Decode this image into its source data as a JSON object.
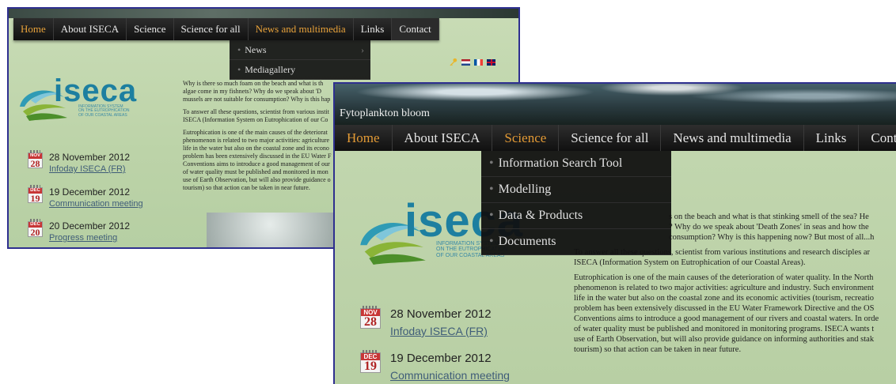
{
  "back": {
    "nav": [
      {
        "label": "Home",
        "active": true
      },
      {
        "label": "About ISECA"
      },
      {
        "label": "Science"
      },
      {
        "label": "Science for all"
      },
      {
        "label": "News and multimedia",
        "active": true
      },
      {
        "label": "Links"
      },
      {
        "label": "Contact"
      }
    ],
    "dropdown": [
      "News",
      "Mediagallery"
    ],
    "logo": {
      "name": "iseca",
      "sub": [
        "INFORMATION SYSTEM",
        "ON THE EUTROPHICATION",
        "OF OUR COASTAL AREAS"
      ]
    },
    "paragraphs": [
      "Why is there so much foam on the beach and what is th",
      "algae come in my fishnets? Why do we speak about 'D",
      "mussels are not suitable for consumption? Why is this hap",
      "To answer all these questions, scientist from various instit",
      "ISECA (Information System on Eutrophication of our Co",
      "Eutrophication is one of the main causes of the deteriorat",
      "phenomenon is related to two major activities: agriculture",
      "life in the water but also on the coastal zone and its econo",
      "problem has been extensively discussed in the EU Water F",
      "Conventions aims to introduce a good management of our",
      "of water quality must be published and monitored in mon",
      "use of Earth Observation, but will also provide guidance o",
      "tourism) so that action can be taken in near future."
    ],
    "events": [
      {
        "month": "NOV",
        "day": "28",
        "date": "28 November 2012",
        "link": "Infoday ISECA (FR)"
      },
      {
        "month": "DEC",
        "day": "19",
        "date": "19 December 2012",
        "link": "Communication meeting"
      },
      {
        "month": "DEC",
        "day": "20",
        "date": "20 December 2012",
        "link": "Progress meeting"
      }
    ]
  },
  "front": {
    "site_title": "Fytoplankton bloom",
    "nav": [
      {
        "label": "Home",
        "active": true
      },
      {
        "label": "About ISECA"
      },
      {
        "label": "Science",
        "active": true
      },
      {
        "label": "Science for all"
      },
      {
        "label": "News and multimedia"
      },
      {
        "label": "Links"
      },
      {
        "label": "Contact"
      }
    ],
    "dropdown": [
      "Information Search Tool",
      "Modelling",
      "Data & Products",
      "Documents"
    ],
    "logo": {
      "name": "iseca",
      "sub": [
        "INFORMATION SYSTEM",
        "ON THE EUTROPHICATION",
        "OF OUR COASTAL AREAS"
      ]
    },
    "paragraphs": [
      "s on the beach and what is that stinking smell of the sea? He",
      "? Why do we speak about 'Death Zones' in seas and how the",
      "consumption? Why is this happening now? But most of all...h",
      "To answer all these questions, scientist from various institutions and research disciples ar",
      "ISECA (Information System on Eutrophication of our Coastal Areas).",
      "Eutrophication is one of the main causes of the deterioration of water quality. In the North",
      "phenomenon is related to two major activities: agriculture and industry. Such environment",
      "life in the water but also on the coastal zone and its economic activities (tourism, recreatio",
      "problem has been extensively discussed in the EU Water Framework Directive and the OS",
      "Conventions aims to introduce a good management of our rivers and coastal waters. In orde",
      "of water quality must be published and monitored in monitoring programs. ISECA wants t",
      "use of Earth Observation, but will also provide guidance on informing authorities and stak",
      "tourism) so that action can be taken in near future."
    ],
    "events": [
      {
        "month": "NOV",
        "day": "28",
        "date": "28 November 2012",
        "link": "Infoday ISECA (FR)"
      },
      {
        "month": "DEC",
        "day": "19",
        "date": "19 December 2012",
        "link": "Communication meeting"
      }
    ]
  },
  "colors": {
    "accent_orange": "#e39a35",
    "frame_blue": "#2e2f8f",
    "calendar_red": "#c83636",
    "logo_teal": "#1d7fa0"
  }
}
